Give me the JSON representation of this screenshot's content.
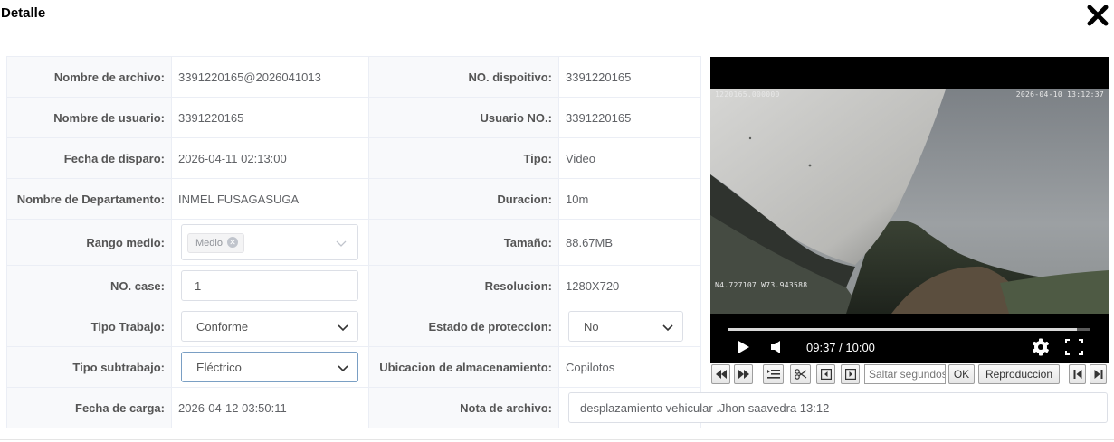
{
  "dialog": {
    "title": "Detalle",
    "close_icon": "close-icon"
  },
  "fields": {
    "nombre_archivo": {
      "label": "Nombre de archivo:",
      "value": "3391220165@2026041013"
    },
    "nombre_usuario": {
      "label": "Nombre de usuario:",
      "value": "3391220165"
    },
    "fecha_disparo": {
      "label": "Fecha de disparo:",
      "value": "2026-04-11 02:13:00"
    },
    "departamento": {
      "label": "Nombre de Departamento:",
      "value": "INMEL FUSAGASUGA"
    },
    "rango_medio": {
      "label": "Rango medio:",
      "tag": "Medio"
    },
    "no_case": {
      "label": "NO. case:",
      "value": "1"
    },
    "tipo_trabajo": {
      "label": "Tipo Trabajo:",
      "value": "Conforme"
    },
    "tipo_subtrabajo": {
      "label": "Tipo subtrabajo:",
      "value": "Eléctrico"
    },
    "fecha_carga": {
      "label": "Fecha de carga:",
      "value": "2026-04-12 03:50:11"
    },
    "no_dispositivo": {
      "label": "NO. dispoitivo:",
      "value": "3391220165"
    },
    "usuario_no": {
      "label": "Usuario NO.:",
      "value": "3391220165"
    },
    "tipo": {
      "label": "Tipo:",
      "value": "Video"
    },
    "duracion": {
      "label": "Duracion:",
      "value": "10m"
    },
    "tamano": {
      "label": "Tamaño:",
      "value": "88.67MB"
    },
    "resolucion": {
      "label": "Resolucion:",
      "value": "1280X720"
    },
    "estado_proteccion": {
      "label": "Estado de proteccion:",
      "value": "No"
    },
    "ubicacion": {
      "label": "Ubicacion de almacenamiento:",
      "value": "Copilotos"
    },
    "nota": {
      "label": "Nota de archivo:",
      "value": "desplazamiento vehicular .Jhon saavedra 13:12"
    }
  },
  "video": {
    "osd_top_left": "1220165.000000",
    "osd_top_right": "2026-04-10 13:12:37",
    "osd_coords": "N4.727107 W73.943588",
    "time_display": "09:37 / 10:00",
    "progress": 0.9617
  },
  "player_controls": {
    "seek_placeholder": "Saltar segundos",
    "ok_label": "OK",
    "playback_label": "Reproduccion"
  }
}
